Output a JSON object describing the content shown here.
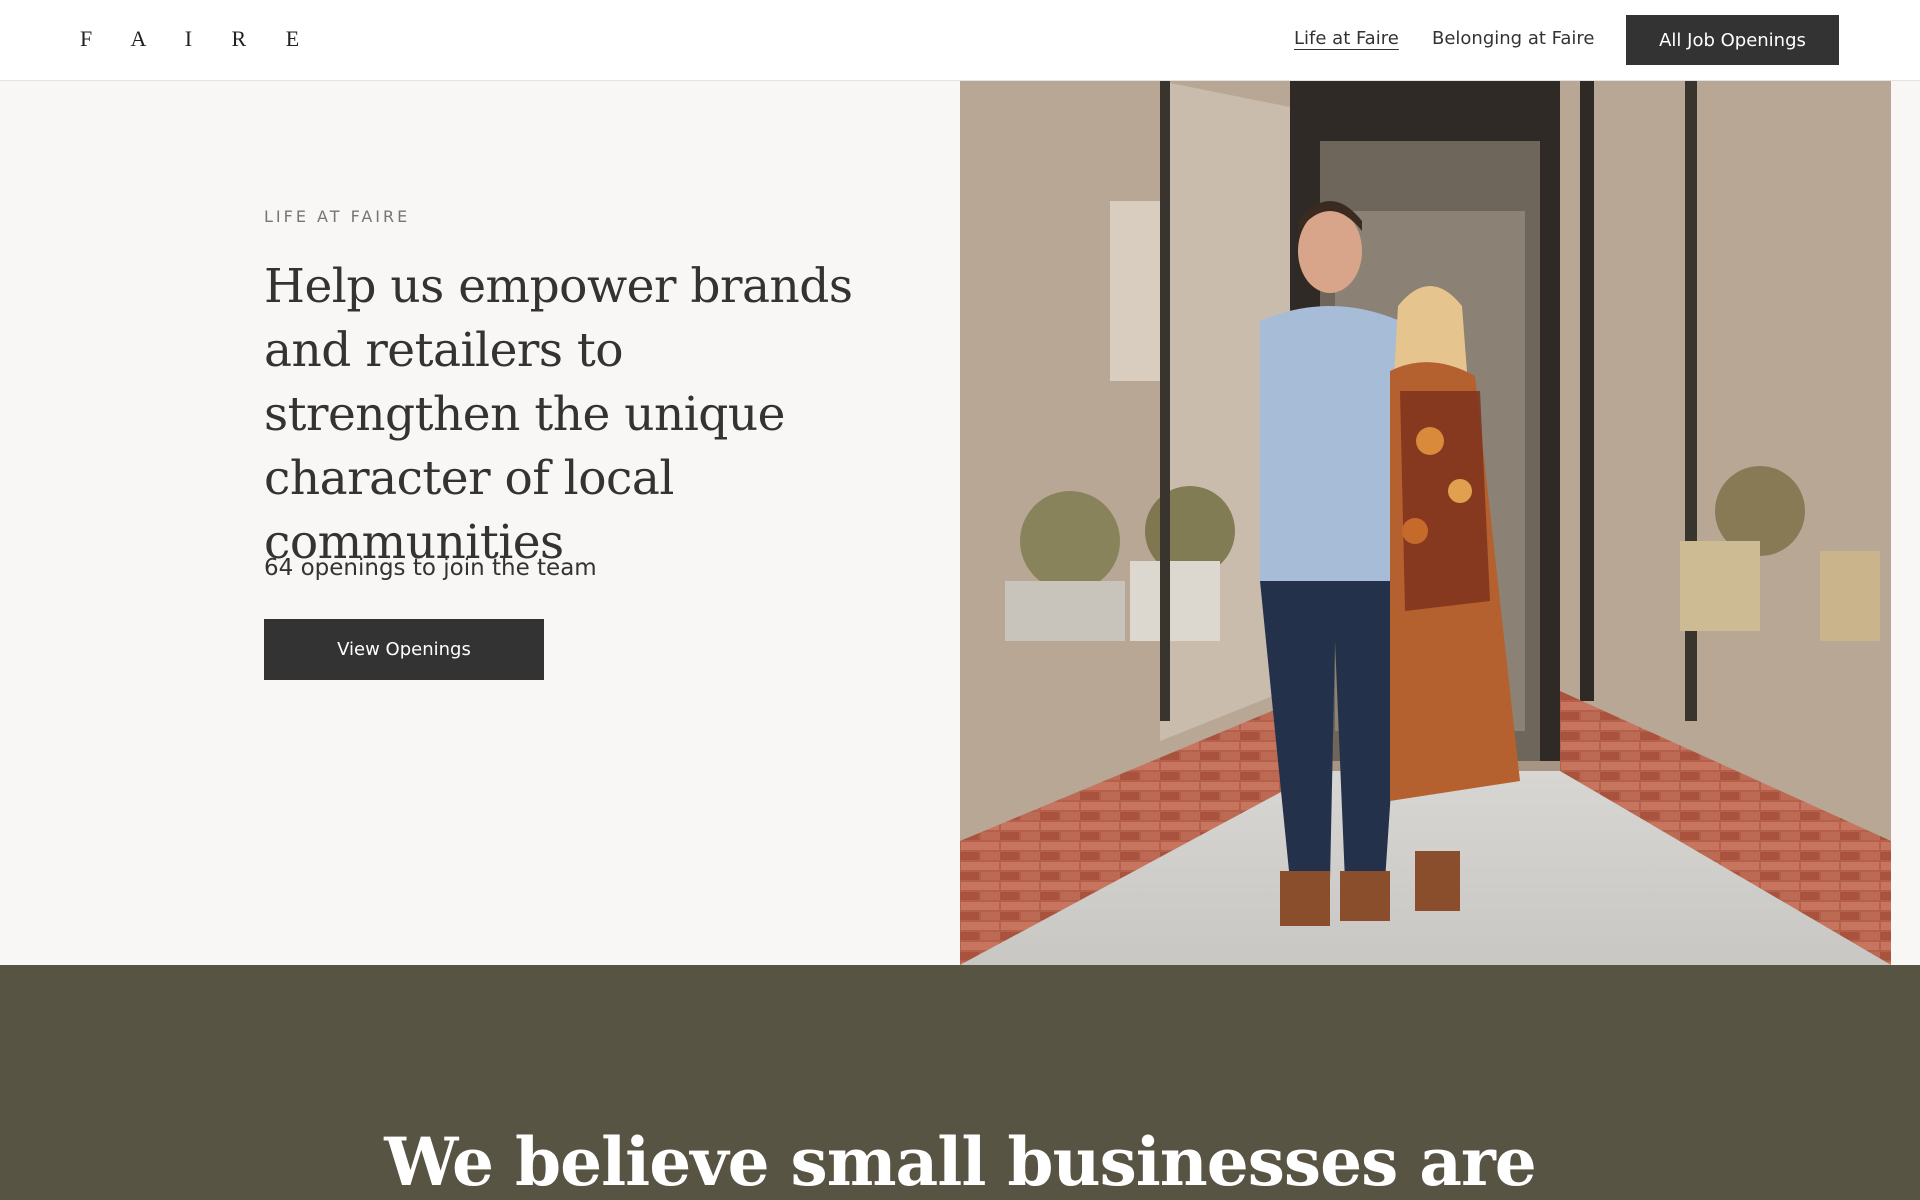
{
  "header": {
    "logo": "F A I R E",
    "nav": {
      "life": "Life at Faire",
      "belonging": "Belonging at Faire"
    },
    "cta": "All Job Openings"
  },
  "hero": {
    "eyebrow": "LIFE AT FAIRE",
    "headline": "Help us empower brands and retailers to strengthen the unique character of local communities",
    "openings": "64 openings to join the team",
    "button": "View Openings",
    "photo_alt": "Two store owners smiling in front of their shop entrance"
  },
  "band": {
    "title": "We believe small businesses are"
  },
  "colors": {
    "dark": "#333333",
    "hero_bg": "#f8f7f5",
    "band_bg": "#585443"
  }
}
